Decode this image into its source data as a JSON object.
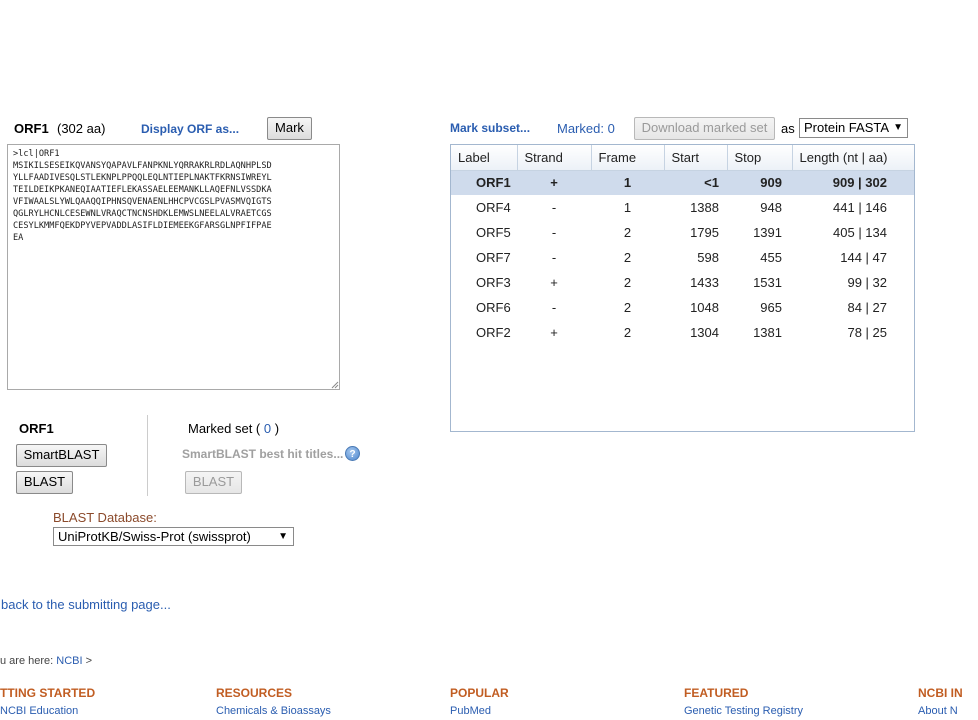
{
  "orf_panel": {
    "title": "ORF1",
    "aa_count": "(302 aa)",
    "display_link": "Display ORF as...",
    "mark_button": "Mark",
    "sequence": ">lcl|ORF1\nMSIKILSESEIKQVANSYQAPAVLFANPKNLYQRRAKRLRDLAQNHPLSD\nYLLFAADIVESQLSTLEKNPLPPQQLEQLNTIEPLNAKTFKRNSIWREYL\nTEILDEIKPKANEQIAATIEFLEKASSAELEEMANKLLAQEFNLVSSDKA\nVFIWAALSLYWLQAAQQIPHNSQVENAENLHHCPVCGSLPVASMVQIGTS\nQGLRYLHCNLCESEWNLVRAQCTNCNSHDKLEMWSLNEELALVRAETCGS\nCESYLKMMFQEKDPYVEPVADDLASIFLDIEMEEKGFARSGLNPFIFPAE\nEA"
  },
  "blast_panel": {
    "orf_label": "ORF1",
    "smartblast_button": "SmartBLAST",
    "blast_button": "BLAST",
    "marked_set_prefix": "Marked set (",
    "marked_set_count": " 0 ",
    "marked_set_suffix": ")",
    "smartblast_hits": "SmartBLAST best hit titles...",
    "help_icon_glyph": "?",
    "blast_button_disabled": "BLAST",
    "database_label": "BLAST Database:",
    "database_value": "UniProtKB/Swiss-Prot (swissprot)"
  },
  "links": {
    "back": "back to the submitting page...",
    "breadcrumb_prefix": "u are here: ",
    "breadcrumb_ncbi": "NCBI",
    "breadcrumb_sep": " >"
  },
  "footer": {
    "columns": [
      "TTING STARTED",
      "RESOURCES",
      "POPULAR",
      "FEATURED",
      "NCBI IN"
    ],
    "links": [
      "NCBI Education",
      "Chemicals & Bioassays",
      "PubMed",
      "Genetic Testing Registry",
      "About N"
    ]
  },
  "orf_list": {
    "mark_subset": "Mark subset...",
    "marked_count": "Marked: 0",
    "download_button": "Download marked set",
    "as_label": "as",
    "format_value": "Protein FASTA",
    "columns": [
      "Label",
      "Strand",
      "Frame",
      "Start",
      "Stop",
      "Length (nt | aa)"
    ],
    "rows": [
      {
        "label": "ORF1",
        "strand": "+",
        "frame": "1",
        "start": "<1",
        "stop": "909",
        "length": "909 | 302"
      },
      {
        "label": "ORF4",
        "strand": "-",
        "frame": "1",
        "start": "1388",
        "stop": "948",
        "length": "441 | 146"
      },
      {
        "label": "ORF5",
        "strand": "-",
        "frame": "2",
        "start": "1795",
        "stop": "1391",
        "length": "405 | 134"
      },
      {
        "label": "ORF7",
        "strand": "-",
        "frame": "2",
        "start": "598",
        "stop": "455",
        "length": "144 | 47"
      },
      {
        "label": "ORF3",
        "strand": "+",
        "frame": "2",
        "start": "1433",
        "stop": "1531",
        "length": "99 | 32"
      },
      {
        "label": "ORF6",
        "strand": "-",
        "frame": "2",
        "start": "1048",
        "stop": "965",
        "length": "84 | 27"
      },
      {
        "label": "ORF2",
        "strand": "+",
        "frame": "2",
        "start": "1304",
        "stop": "1381",
        "length": "78 | 25"
      }
    ]
  },
  "colors": {
    "link": "#2a5db0",
    "footer_heading": "#c15d22",
    "selected_row": "#cfdbec"
  }
}
